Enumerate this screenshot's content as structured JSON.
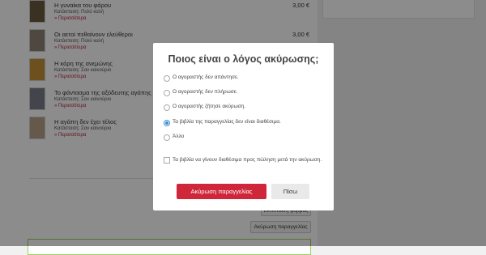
{
  "orders": [
    {
      "title": "Η γυναίκα του φάρου",
      "condition": "Κατάσταση: Πολύ καλή",
      "more": "» Περισσότερα",
      "price": "3,00 €",
      "cover_color": "#6a5a3e"
    },
    {
      "title": "Οι αετοί πεθαίνουν ελεύθεροι",
      "condition": "Κατάσταση: Πολύ καλή",
      "more": "» Περισσότερα",
      "price": "3,00 €",
      "cover_color": "#8e8476"
    },
    {
      "title": "Η κόρη της ανεμώνης",
      "condition": "Κατάσταση: Σαν καινούριο",
      "more": "» Περισσότερα",
      "price": "",
      "cover_color": "#c59236"
    },
    {
      "title": "Το φάντασμα της αξόδευτης αγάπης",
      "condition": "Κατάσταση: Σαν καινούριο",
      "more": "» Περισσότερα",
      "price": "",
      "cover_color": "#7c7f8a"
    },
    {
      "title": "Η αγάπη δεν έχει τέλος",
      "condition": "Κατάσταση: Σαν καινούριο",
      "more": "» Περισσότερα",
      "price": "",
      "cover_color": "#b9a28b"
    }
  ],
  "page_buttons": {
    "print_label": "Εκτύπωση φόρμας",
    "cancel_order_label": "Ακύρωση παραγγελίας"
  },
  "modal": {
    "title": "Ποιος είναι ο λόγος ακύρωσης;",
    "options": [
      {
        "label": "Ο αγοραστής δεν απάντησε.",
        "checked": false
      },
      {
        "label": "Ο αγοραστής δεν πλήρωσε.",
        "checked": false
      },
      {
        "label": "Ο αγοραστής ζήτησε ακύρωση.",
        "checked": false
      },
      {
        "label": "Τα βιβλία της παραγγελίας δεν είναι διαθέσιμα.",
        "checked": true
      },
      {
        "label": "Άλλο",
        "checked": false
      }
    ],
    "checkbox_label": "Τα βιβλία να γίνουν διαθέσιμα προς πώληση μετά την ακύρωση.",
    "checkbox_checked": false,
    "cancel_order_button": "Ακύρωση παραγγελίας",
    "back_button": "Πίσω",
    "accent_color": "#d0263a"
  }
}
